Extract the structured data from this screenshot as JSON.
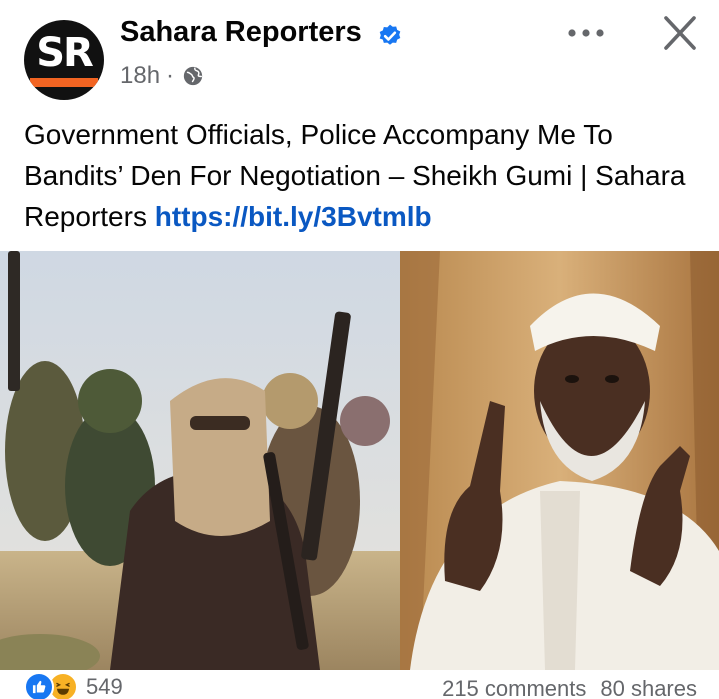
{
  "post": {
    "page_name": "Sahara Reporters",
    "avatar_text": "SR",
    "time": "18h",
    "separator": "·",
    "audience_icon": "globe-icon",
    "verified_icon": "verified-badge-icon",
    "caption_text": "Government Officials, Police Accompany Me To Bandits’ Den For Negotiation – Sheikh Gumi | Sahara Reporters ",
    "caption_link": "https://bit.ly/3Bvtmlb"
  },
  "actions": {
    "more_icon": "more-options-icon",
    "close_icon": "close-icon"
  },
  "footer": {
    "reaction_icons": [
      "like-reaction-icon",
      "haha-reaction-icon"
    ],
    "reaction_count": "549",
    "comments": "215 comments",
    "shares": "80 shares"
  },
  "colors": {
    "link": "#0a58c2",
    "verified": "#1877f2",
    "avatar_accent": "#f26422",
    "secondary_text": "#65676b"
  }
}
